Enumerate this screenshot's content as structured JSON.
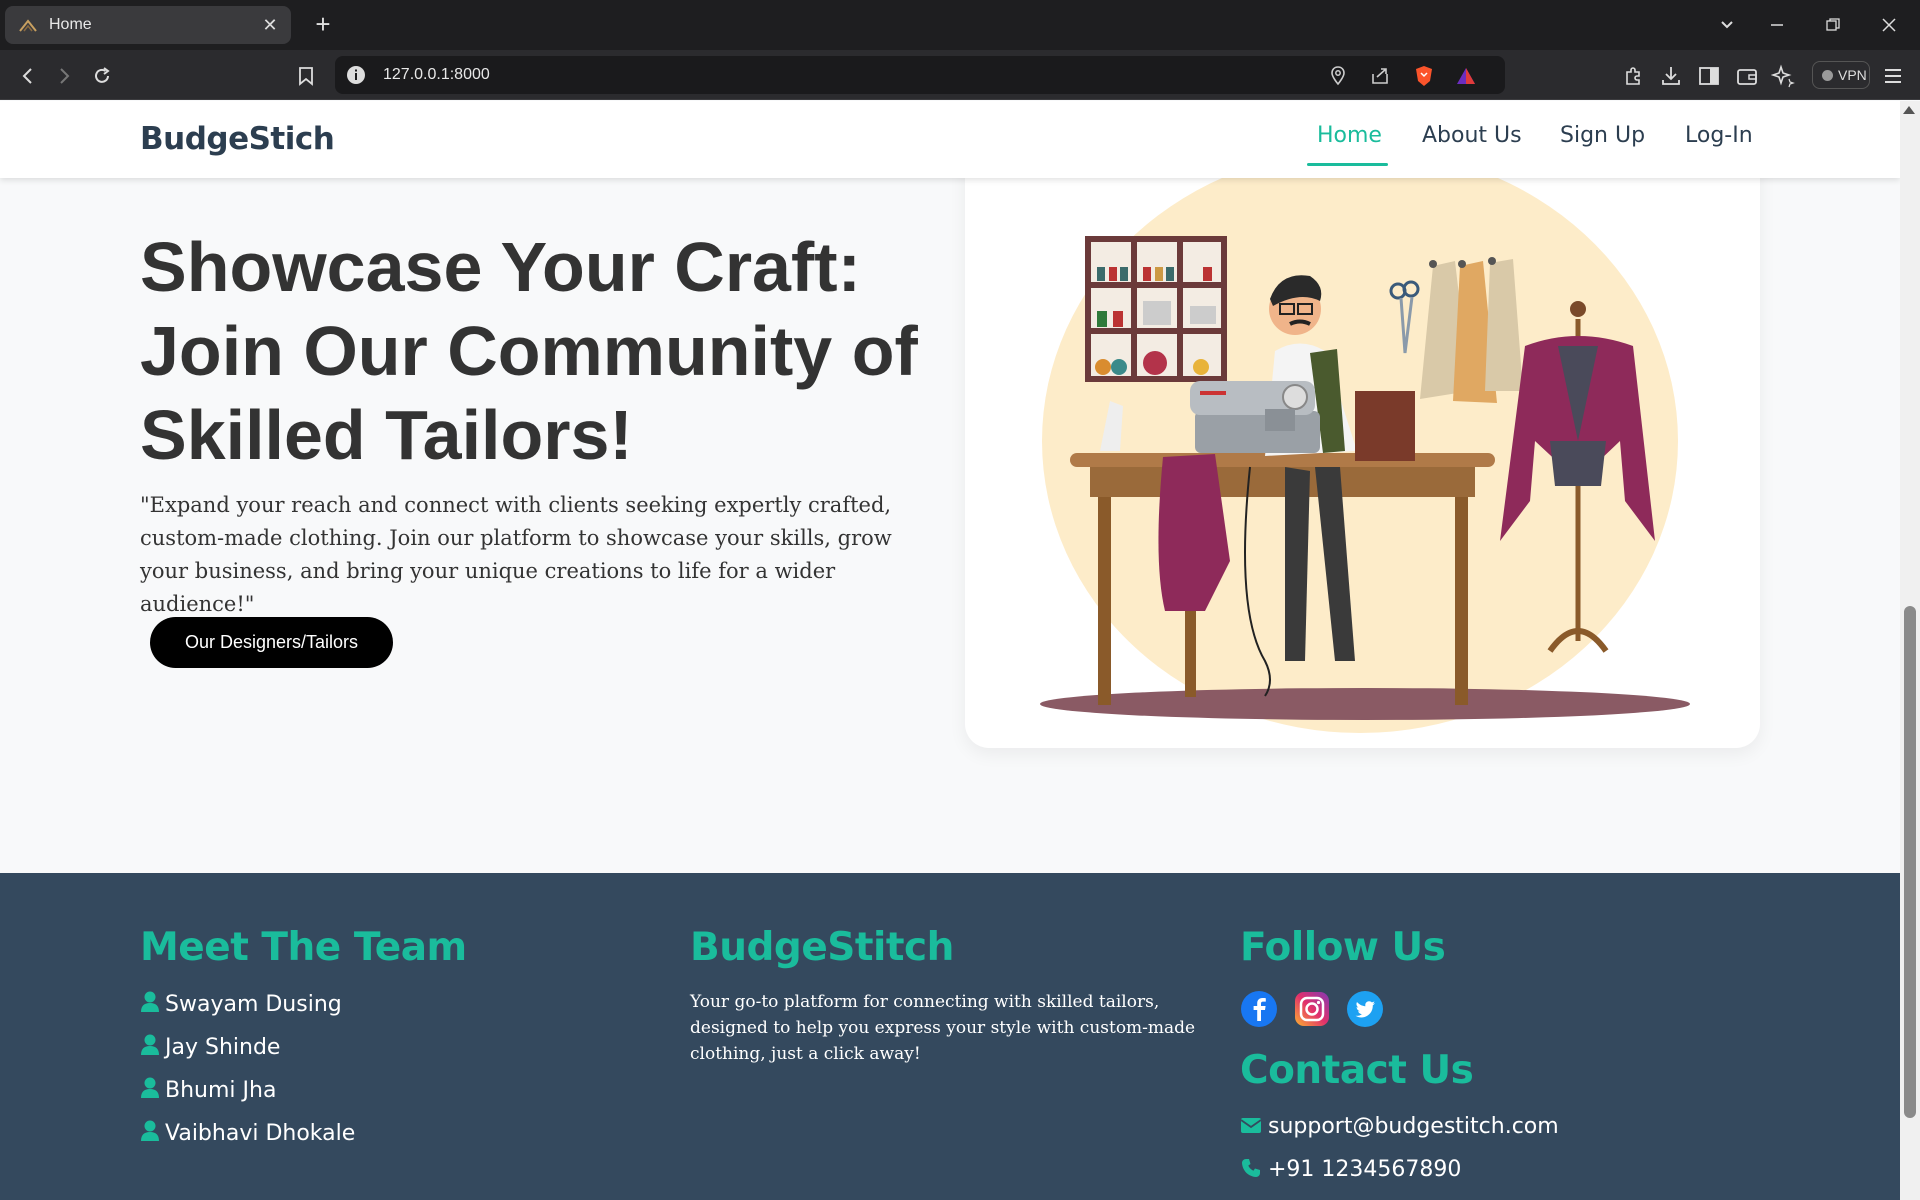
{
  "browser": {
    "tab_title": "Home",
    "url": "127.0.0.1:8000",
    "vpn_label": "VPN"
  },
  "navbar": {
    "brand": "BudgeStich",
    "links": [
      {
        "label": "Home",
        "active": true
      },
      {
        "label": "About Us",
        "active": false
      },
      {
        "label": "Sign Up",
        "active": false
      },
      {
        "label": "Log-In",
        "active": false
      }
    ]
  },
  "hero": {
    "title_lines": [
      "Showcase Your Craft:",
      "Join Our Community of",
      "Skilled Tailors!"
    ],
    "description": "\"Expand your reach and connect with clients seeking expertly crafted, custom-made clothing. Join our platform to showcase your skills, grow your business, and bring your unique creations to life for a wider audience!\"",
    "button_label": "Our Designers/Tailors",
    "illustration": "tailor-at-sewing-machine-illustration"
  },
  "footer": {
    "team_heading": "Meet The Team",
    "team_members": [
      "Swayam Dusing",
      "Jay Shinde",
      "Bhumi Jha",
      "Vaibhavi Dhokale"
    ],
    "about_heading": "BudgeStitch",
    "about_text": "Your go-to platform for connecting with skilled tailors, designed to help you express your style with custom-made clothing, just a click away!",
    "follow_heading": "Follow Us",
    "social_icons": [
      "facebook-icon",
      "instagram-icon",
      "twitter-icon"
    ],
    "contact_heading": "Contact Us",
    "email": "support@budgestitch.com",
    "phone": "+91 1234567890"
  },
  "colors": {
    "accent": "#1abc9c",
    "footer_bg": "#34495e",
    "brand_text": "#2c3e50"
  }
}
